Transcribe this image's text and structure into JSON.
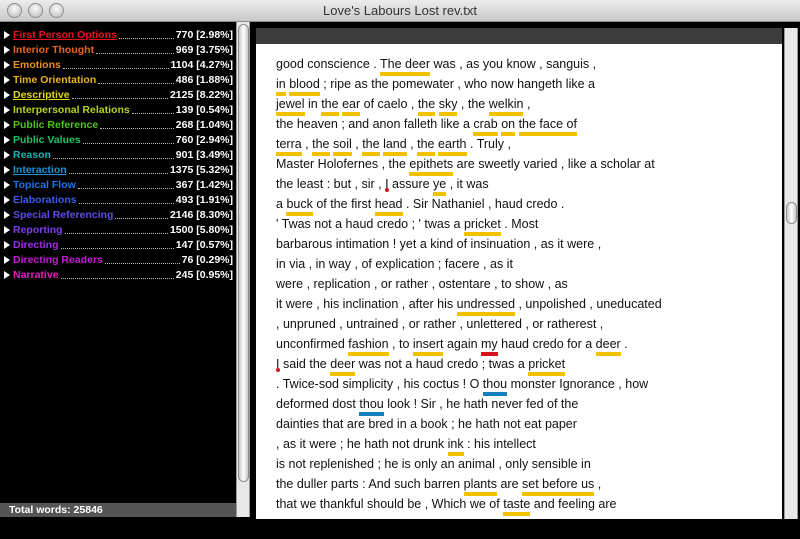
{
  "window": {
    "title": "Love's Labours Lost rev.txt"
  },
  "categories": [
    {
      "name": "First Person Options",
      "count": "770",
      "pct": "[2.98%]",
      "color": "#e8141c",
      "underline": true
    },
    {
      "name": "Interior Thought",
      "count": "969",
      "pct": "[3.75%]",
      "color": "#e8641c"
    },
    {
      "name": "Emotions",
      "count": "1104",
      "pct": "[4.27%]",
      "color": "#e8901c"
    },
    {
      "name": "Time Orientation",
      "count": "486",
      "pct": "[1.88%]",
      "color": "#e8b41c"
    },
    {
      "name": "Descriptive",
      "count": "2125",
      "pct": "[8.22%]",
      "color": "#e8d41c",
      "underline": true
    },
    {
      "name": "Interpersonal Relations",
      "count": "139",
      "pct": "[0.54%]",
      "color": "#b4d41c"
    },
    {
      "name": "Public Reference",
      "count": "268",
      "pct": "[1.04%]",
      "color": "#50c41c"
    },
    {
      "name": "Public Values",
      "count": "760",
      "pct": "[2.94%]",
      "color": "#1cc464"
    },
    {
      "name": "Reason",
      "count": "901",
      "pct": "[3.49%]",
      "color": "#1cb4b4"
    },
    {
      "name": "Interaction",
      "count": "1375",
      "pct": "[5.32%]",
      "color": "#1c94d4",
      "underline": true
    },
    {
      "name": "Topical Flow",
      "count": "367",
      "pct": "[1.42%]",
      "color": "#1c74e8"
    },
    {
      "name": "Elaborations",
      "count": "493",
      "pct": "[1.91%]",
      "color": "#3c5ce8"
    },
    {
      "name": "Special Referencing",
      "count": "2146",
      "pct": "[8.30%]",
      "color": "#5c4ce8"
    },
    {
      "name": "Reporting",
      "count": "1500",
      "pct": "[5.80%]",
      "color": "#7c3ce8"
    },
    {
      "name": "Directing",
      "count": "147",
      "pct": "[0.57%]",
      "color": "#9c2ce8"
    },
    {
      "name": "Directing Readers",
      "count": "76",
      "pct": "[0.29%]",
      "color": "#c41cd4"
    },
    {
      "name": "Narrative",
      "count": "245",
      "pct": "[0.95%]",
      "color": "#e81cc4"
    }
  ],
  "total": {
    "label": "Total words: 25846"
  },
  "document": {
    "lines": [
      [
        [
          "good conscience . ",
          ""
        ],
        [
          "The deer",
          "y"
        ],
        [
          " was , as you know , sanguis ,",
          ""
        ]
      ],
      [
        [
          "in",
          "y"
        ],
        [
          " ",
          ""
        ],
        [
          "blood",
          "y"
        ],
        [
          " ; ripe as the pomewater , who now hangeth like a",
          ""
        ]
      ],
      [
        [
          "jewel",
          "y"
        ],
        [
          " in ",
          ""
        ],
        [
          "the",
          "y"
        ],
        [
          " ",
          ""
        ],
        [
          "ear",
          "y"
        ],
        [
          " of caelo , ",
          ""
        ],
        [
          "the",
          "y"
        ],
        [
          " ",
          ""
        ],
        [
          "sky",
          "y"
        ],
        [
          " , the ",
          ""
        ],
        [
          "welkin",
          "y"
        ],
        [
          " ,",
          ""
        ]
      ],
      [
        [
          "the heaven ; and anon falleth like a ",
          ""
        ],
        [
          "crab",
          "y"
        ],
        [
          " ",
          ""
        ],
        [
          "on",
          "y"
        ],
        [
          " ",
          ""
        ],
        [
          "the face of",
          "y"
        ]
      ],
      [
        [
          "terra",
          "y"
        ],
        [
          " , ",
          ""
        ],
        [
          "the",
          "y"
        ],
        [
          " ",
          ""
        ],
        [
          "soil",
          "y"
        ],
        [
          " , ",
          ""
        ],
        [
          "the",
          "y"
        ],
        [
          " ",
          ""
        ],
        [
          "land",
          "y"
        ],
        [
          " , ",
          ""
        ],
        [
          "the",
          "y"
        ],
        [
          " ",
          ""
        ],
        [
          "earth",
          "y"
        ],
        [
          " . Truly ,",
          ""
        ]
      ],
      [
        [
          "Master Holofernes , the ",
          ""
        ],
        [
          "epithets",
          "y"
        ],
        [
          " are sweetly varied , like a scholar at",
          ""
        ]
      ],
      [
        [
          "the least : but , sir , ",
          ""
        ],
        [
          "I",
          "rd"
        ],
        [
          " assure ",
          ""
        ],
        [
          "ye",
          "y"
        ],
        [
          " , it was",
          ""
        ]
      ],
      [
        [
          "a ",
          ""
        ],
        [
          "buck",
          "y"
        ],
        [
          " of the first ",
          ""
        ],
        [
          "head",
          "y"
        ],
        [
          " . Sir Nathaniel , haud credo .",
          ""
        ]
      ],
      [
        [
          "' Twas not a haud credo ; ' twas a ",
          ""
        ],
        [
          "pricket",
          "y"
        ],
        [
          " . Most",
          ""
        ]
      ],
      [
        [
          "barbarous intimation ! yet a kind of insinuation , as it were ,",
          ""
        ]
      ],
      [
        [
          "in via , in way , of explication ; facere , as it",
          ""
        ]
      ],
      [
        [
          "were , replication , or rather , ostentare , to show , as",
          ""
        ]
      ],
      [
        [
          "it were , his inclination , after his ",
          ""
        ],
        [
          "undressed",
          "y"
        ],
        [
          " , unpolished , uneducated",
          ""
        ]
      ],
      [
        [
          ", unpruned , untrained , or rather , unlettered , or ratherest ,",
          ""
        ]
      ],
      [
        [
          "unconfirmed ",
          ""
        ],
        [
          "fashion",
          "y"
        ],
        [
          " , to ",
          ""
        ],
        [
          "insert",
          "y"
        ],
        [
          " again ",
          ""
        ],
        [
          "my",
          "r"
        ],
        [
          " haud credo for a ",
          ""
        ],
        [
          "deer",
          "y"
        ],
        [
          " .",
          ""
        ]
      ],
      [
        [
          "I",
          "rd"
        ],
        [
          " said the ",
          ""
        ],
        [
          "deer",
          "y"
        ],
        [
          " was not a haud credo ; twas a ",
          ""
        ],
        [
          "pricket",
          "y"
        ]
      ],
      [
        [
          ". Twice-sod simplicity , his coctus ! O ",
          ""
        ],
        [
          "thou",
          "b"
        ],
        [
          " monster Ignorance , how",
          ""
        ]
      ],
      [
        [
          "deformed dost ",
          ""
        ],
        [
          "thou",
          "b"
        ],
        [
          " look ! Sir , he hath never fed of the",
          ""
        ]
      ],
      [
        [
          "dainties that are bred in a book ; he hath not eat paper",
          ""
        ]
      ],
      [
        [
          ", as it were ; he hath not drunk ",
          ""
        ],
        [
          "ink",
          "y"
        ],
        [
          " : his intellect",
          ""
        ]
      ],
      [
        [
          "is not replenished ; he is only an animal , only sensible in",
          ""
        ]
      ],
      [
        [
          "the duller parts : And such barren ",
          ""
        ],
        [
          "plants",
          "y"
        ],
        [
          " are ",
          ""
        ],
        [
          "set before us",
          "y"
        ],
        [
          " ,",
          ""
        ]
      ],
      [
        [
          "that we thankful should be , Which we of ",
          ""
        ],
        [
          "taste",
          "y"
        ],
        [
          " and feeling are",
          ""
        ]
      ]
    ]
  }
}
